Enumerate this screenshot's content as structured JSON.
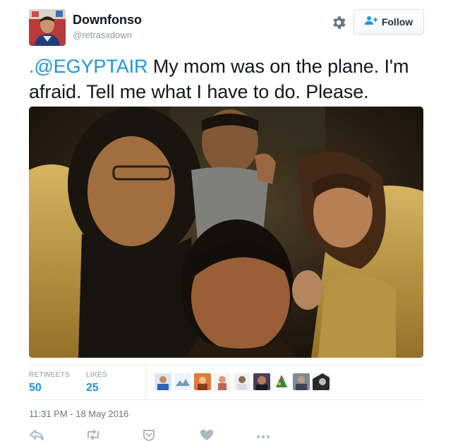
{
  "user": {
    "display_name": "Downfonso",
    "screen_name": "@retrasxdown"
  },
  "follow_button": {
    "label": "Follow",
    "icon": "add-user-icon"
  },
  "settings_icon": "gear-icon",
  "tweet": {
    "mention": ".@EGYPTAIR",
    "text": " My mom was on the plane. I'm afraid. Tell me what I have to do. Please."
  },
  "stats": {
    "retweets_label": "RETWEETS",
    "retweets_value": "50",
    "likes_label": "LIKES",
    "likes_value": "25"
  },
  "timestamp": "11:31 PM - 18 May 2016",
  "actions": [
    "reply-icon",
    "retweet-icon",
    "save-icon",
    "like-icon",
    "more-icon"
  ],
  "colors": {
    "accent": "#1b95e0",
    "text": "#14171a",
    "muted": "#8899a6",
    "border": "#e6ecf0"
  }
}
